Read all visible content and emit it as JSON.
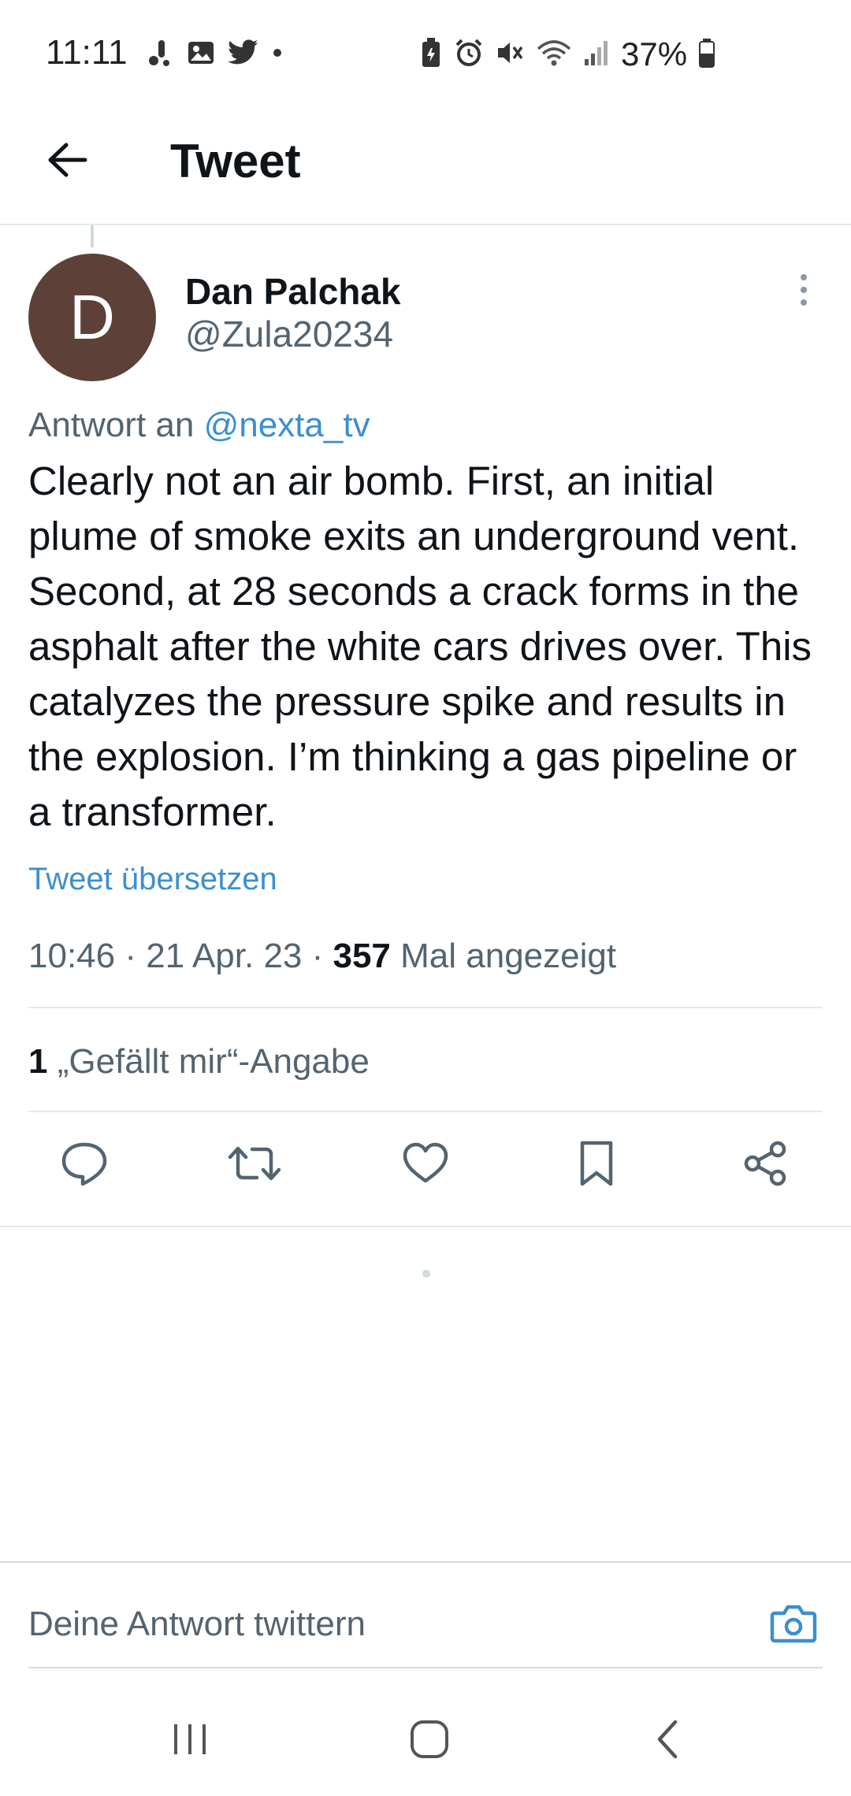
{
  "status_bar": {
    "time": "11:11",
    "battery": "37%",
    "left_icons": [
      "notification-icon",
      "image-icon",
      "twitter-icon",
      "dot-icon"
    ],
    "right_icons": [
      "battery-saver-icon",
      "alarm-icon",
      "mute-icon",
      "wifi-icon",
      "signal-icon",
      "battery-icon"
    ]
  },
  "header": {
    "title": "Tweet",
    "back_icon": "arrow-left-icon"
  },
  "tweet": {
    "avatar_letter": "D",
    "avatar_color": "#5d4037",
    "display_name": "Dan Palchak",
    "handle": "@Zula20234",
    "reply_prefix": "Antwort an",
    "reply_handle": "@nexta_tv",
    "text": "Clearly not an air bomb. First, an initial plume of smoke exits an underground vent. Second, at 28 seconds a crack forms in the asphalt after the white cars drives over. This catalyzes the pressure spike and results in the explosion. I’m thinking a gas pipeline or a transformer.",
    "translate_label": "Tweet übersetzen",
    "timestamp": "10:46 · 21 Apr. 23 · ",
    "views_count": "357",
    "views_label": " Mal angezeigt",
    "likes_count": "1",
    "likes_label": " „Gefällt mir“-Angabe"
  },
  "actions": [
    {
      "name": "reply-icon"
    },
    {
      "name": "retweet-icon"
    },
    {
      "name": "like-icon"
    },
    {
      "name": "bookmark-icon"
    },
    {
      "name": "share-icon"
    }
  ],
  "composer": {
    "placeholder": "Deine Antwort twittern",
    "camera_icon": "camera-icon"
  },
  "colors": {
    "link": "#3b8fd0",
    "secondary_text": "#536471",
    "divider": "#e6e9eb"
  }
}
